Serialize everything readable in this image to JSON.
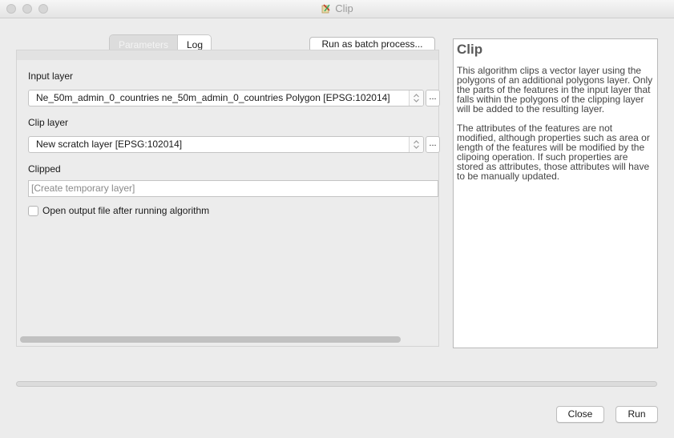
{
  "window": {
    "title": "Clip"
  },
  "tabs": [
    {
      "label": "Parameters",
      "active": true
    },
    {
      "label": "Log",
      "active": false
    }
  ],
  "batch_button": "Run as batch process...",
  "parameters": {
    "input_layer": {
      "label": "Input layer",
      "value": "Ne_50m_admin_0_countries ne_50m_admin_0_countries Polygon [EPSG:102014]",
      "browse": "..."
    },
    "clip_layer": {
      "label": "Clip layer",
      "value": "New scratch layer [EPSG:102014]",
      "browse": "..."
    },
    "clipped": {
      "label": "Clipped",
      "placeholder": "[Create temporary layer]"
    },
    "open_output": {
      "label": "Open output file after running algorithm",
      "checked": false
    }
  },
  "help": {
    "title": "Clip",
    "paragraphs": [
      "This algorithm clips a vector layer using the polygons of an additional polygons layer. Only the parts of the features in the input layer that falls within the polygons of the clipping layer will be added to the resulting layer.",
      "The attributes of the features are not modified, although properties such as area or length of the features will be modified by the clipoing operation. If such properties are stored as attributes, those attributes will have to be manually updated."
    ]
  },
  "progress": 0,
  "buttons": {
    "close": "Close",
    "run": "Run"
  },
  "icons": {
    "app": "qgis-clip-icon",
    "combo": "updown-chevron-icon"
  }
}
